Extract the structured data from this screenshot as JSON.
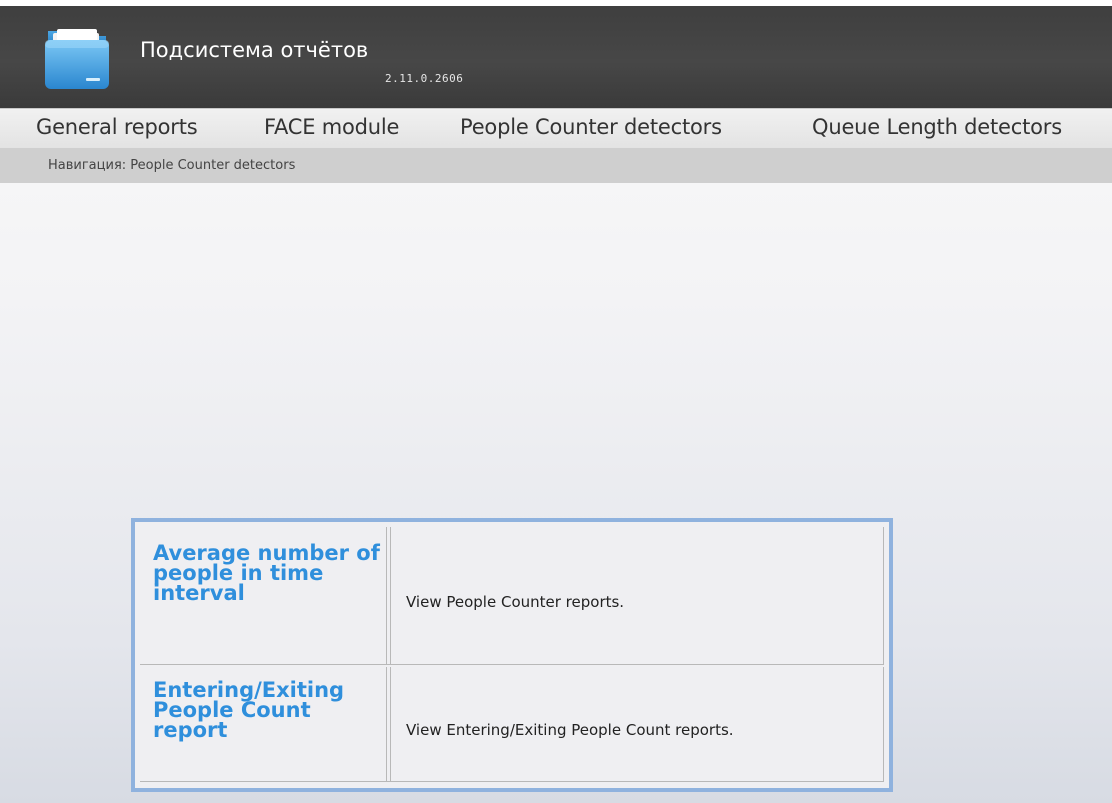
{
  "header": {
    "title": "Подсистема отчётов",
    "version": "2.11.0.2606",
    "logo_icon": "folder-icon"
  },
  "menu": {
    "items": [
      {
        "label": "General reports"
      },
      {
        "label": "FACE module"
      },
      {
        "label": "People Counter detectors"
      },
      {
        "label": "Queue Length detectors"
      }
    ]
  },
  "navigation": {
    "text": "Навигация: People Counter detectors"
  },
  "reports": [
    {
      "title": "Average number of people in time interval",
      "description": "View People Counter reports."
    },
    {
      "title": "Entering/Exiting People Count report",
      "description": "View Entering/Exiting People Count reports."
    }
  ],
  "colors": {
    "header_bg": "#444444",
    "link": "#2f8fdc",
    "table_border": "#8fb2de"
  }
}
